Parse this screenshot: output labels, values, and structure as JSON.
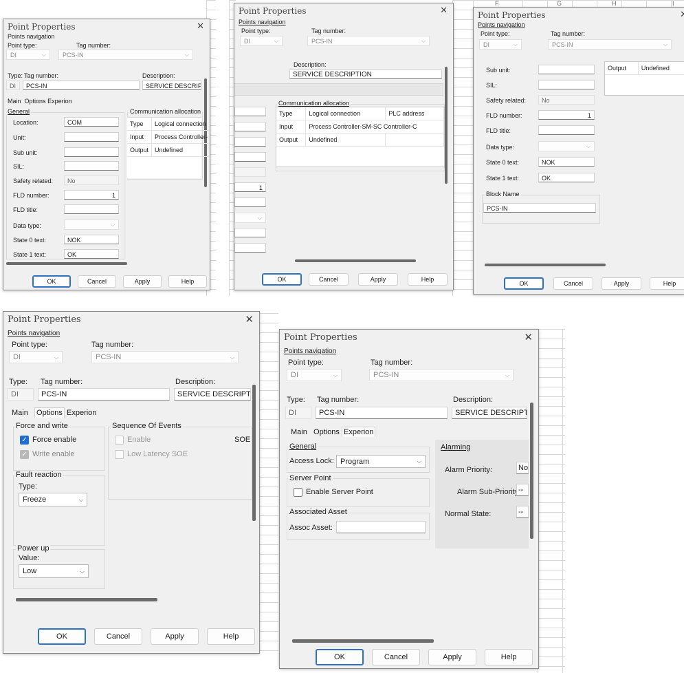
{
  "labels": {
    "dialog_title": "Point Properties",
    "points_navigation": "Points navigation",
    "point_type": "Point type:",
    "tag_number": "Tag number:",
    "type": "Type:",
    "description": "Description:",
    "tab_main": "Main",
    "tab_options": "Options",
    "tab_experion": "Experion",
    "general": "General",
    "comm_allocation": "Communication allocation",
    "location": "Location:",
    "unit": "Unit:",
    "sub_unit": "Sub unit:",
    "sil": "SIL:",
    "safety_related": "Safety related:",
    "fld_number": "FLD number:",
    "fld_title": "FLD title:",
    "data_type": "Data type:",
    "state0": "State 0 text:",
    "state1": "State 1 text:",
    "block_name": "Block Name",
    "force_and_write": "Force and write",
    "force_enable": "Force enable",
    "write_enable": "Write enable",
    "sequence_of_events": "Sequence Of Events",
    "enable": "Enable",
    "soe": "SOE",
    "low_latency_soe": "Low Latency SOE",
    "fault_reaction": "Fault reaction",
    "type_short": "Type:",
    "power_up": "Power up",
    "value": "Value:",
    "access_lock": "Access Lock:",
    "server_point": "Server Point",
    "enable_server_point": "Enable Server Point",
    "associated_asset": "Associated Asset",
    "assoc_asset": "Assoc Asset:",
    "alarming": "Alarming",
    "alarm_priority": "Alarm Priority:",
    "alarm_sub_priority": "Alarm Sub-Priority:",
    "normal_state": "Normal State:"
  },
  "values": {
    "point_type": "DI",
    "tag": "PCS-IN",
    "description": "SERVICE DESCRIPTI",
    "description_full": "SERVICE DESCRIPTION",
    "location": "COM",
    "safety_related": "No",
    "fld_number": "1",
    "state0": "NOK",
    "state1": "OK",
    "fault_type": "Freeze",
    "power_up_value": "Low",
    "access_lock": "Program",
    "alarm_priority": "No",
    "alarm_sub_priority": "--",
    "normal_state": "--"
  },
  "comm_table": {
    "header": [
      "Type",
      "Logical connection",
      "PLC address"
    ],
    "input_label": "Input",
    "input_value": "Process Controller-SM-SC Controller-C",
    "input_value_short": "Process Controller-",
    "output_label": "Output",
    "output_value": "Undefined"
  },
  "buttons": {
    "ok": "OK",
    "cancel": "Cancel",
    "apply": "Apply",
    "help": "Help"
  },
  "grid_cols": [
    "F",
    "G",
    "H",
    "I"
  ],
  "colors": {
    "accent": "#1f6fd0",
    "dialog_bg": "#f0f0f0"
  }
}
